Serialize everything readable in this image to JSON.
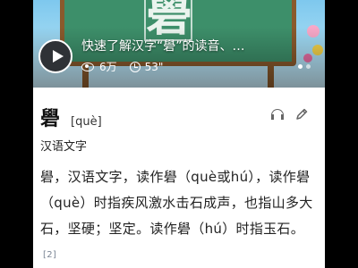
{
  "video": {
    "board_character": "礐",
    "title": "快速了解汉字“礐”的读音、…",
    "views": "6万",
    "duration": "53\""
  },
  "entry": {
    "character": "礐",
    "pinyin": "[què]",
    "category": "汉语文字",
    "description": "礐，汉语文字，读作礐（què或hú），读作礐（què）时指疾风激水击石成声，也指山多大石，坚硬；坚定。读作礐（hú）时指玉石。",
    "reference": "[2]"
  },
  "icons": {
    "audio": "headphones-icon",
    "edit": "pencil-icon",
    "play": "play-icon"
  }
}
